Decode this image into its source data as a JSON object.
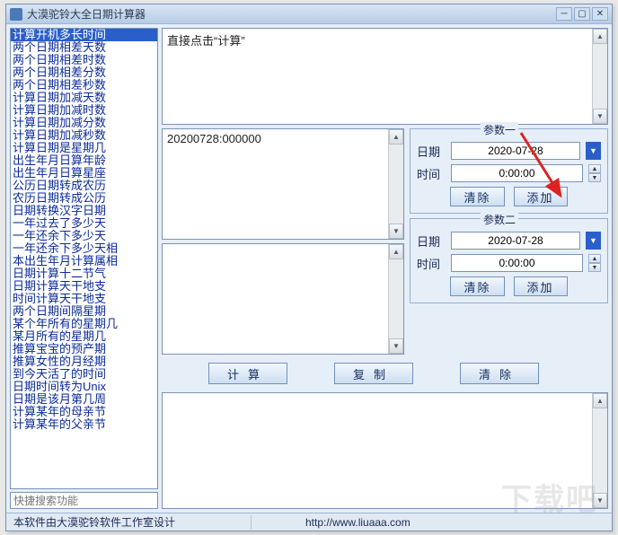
{
  "window": {
    "title": "大漠驼铃大全日期计算器",
    "min_aria": "minimize",
    "max_aria": "maximize",
    "close_aria": "close"
  },
  "sidebar": {
    "items": [
      "计算开机多长时间",
      "两个日期相差天数",
      "两个日期相差时数",
      "两个日期相差分数",
      "两个日期相差秒数",
      "计算日期加减天数",
      "计算日期加减时数",
      "计算日期加减分数",
      "计算日期加减秒数",
      "计算日期是星期几",
      "出生年月日算年龄",
      "出生年月日算星座",
      "公历日期转成农历",
      "农历日期转成公历",
      "日期转换汉字日期",
      "一年过去了多少天",
      "一年还余下多少天",
      "一年还余下多少天相",
      "本出生年月计算属相",
      "日期计算十二节气",
      "日期计算天干地支",
      "时间计算天干地支",
      "两个日期间隔星期",
      "某个年所有的星期几",
      "某月所有的星期几",
      "推算宝宝的预产期",
      "推算女性的月经期",
      "到今天活了的时间",
      "日期时间转为Unix",
      "日期是该月第几周",
      "计算某年的母亲节",
      "计算某年的父亲节"
    ],
    "selected_index": 0,
    "search_placeholder": "快捷搜索功能"
  },
  "top_textarea": {
    "text": "直接点击“计算”"
  },
  "mid_textareas": {
    "upper": "20200728:000000",
    "lower": ""
  },
  "params1": {
    "legend": "参数一",
    "date_label": "日期",
    "date_value": "2020-07-28",
    "time_label": "时间",
    "time_value": "0:00:00",
    "clear_label": "清除",
    "add_label": "添加"
  },
  "params2": {
    "legend": "参数二",
    "date_label": "日期",
    "date_value": "2020-07-28",
    "time_label": "时间",
    "time_value": "0:00:00",
    "clear_label": "清除",
    "add_label": "添加"
  },
  "actions": {
    "calc": "计算",
    "copy": "复制",
    "clear": "清除"
  },
  "statusbar": {
    "left": "本软件由大漠驼铃软件工作室设计",
    "url": "http://www.liuaaa.com"
  },
  "watermark": "下载吧"
}
